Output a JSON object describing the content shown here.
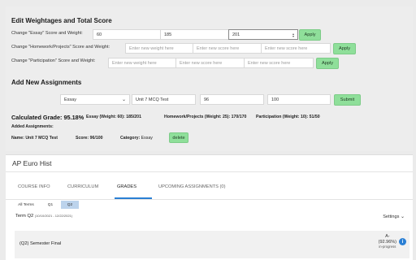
{
  "edit": {
    "title": "Edit Weightages and Total Score",
    "rows": [
      {
        "label": "Change \"Essay\" Score and Weight:",
        "weight": "60",
        "score": "185",
        "total": "201",
        "button": "Apply"
      },
      {
        "label": "Change \"Homework/Projects\" Score and Weight:",
        "weight_placeholder": "Enter new weight here",
        "score_placeholder": "Enter new score here",
        "total_placeholder": "Enter new score here",
        "button": "Apply"
      },
      {
        "label": "Change \"Participation\" Score and Weight:",
        "weight_placeholder": "Enter new weight here",
        "score_placeholder": "Enter new score here",
        "total_placeholder": "Enter new score here",
        "button": "Apply"
      }
    ]
  },
  "add": {
    "title": "Add New Assignments",
    "category": "Essay",
    "name": "Unit 7 MCQ Test",
    "score": "96",
    "total": "100",
    "submit": "Submit"
  },
  "summary": {
    "calculated": "Calculated Grade: 95.18%",
    "essay": "Essay (Weight: 60): 185/201",
    "homework": "Homework/Projects (Weight: 25): 170/170",
    "participation": "Participation (Weight: 10): 51/50",
    "added_heading": "Added Assignments:",
    "assignment": {
      "name_label": "Name:",
      "name": "Unit 7 MCQ Test",
      "score_label": "Score:",
      "score": "96/100",
      "category_label": "Category:",
      "category": "Essay",
      "delete": "delete"
    }
  },
  "course": {
    "title": "AP Euro Hist",
    "tabs": [
      "COURSE INFO",
      "CURRICULUM",
      "GRADES",
      "UPCOMING ASSIGNMENTS (0)"
    ],
    "term_tabs": [
      "All Terms",
      "Q1",
      "Q2"
    ],
    "term": "Term Q2",
    "term_dates": "(10/10/2021 - 12/22/2021)",
    "settings": "Settings",
    "final": {
      "name": "(Q2) Semester Final",
      "letter": "A-",
      "percent": "(92.96%)",
      "status": "in-progress"
    }
  },
  "colors": {
    "accent": "#2a7fd4",
    "button": "#8fdf9a",
    "selected_term": "#bcd3ec"
  }
}
